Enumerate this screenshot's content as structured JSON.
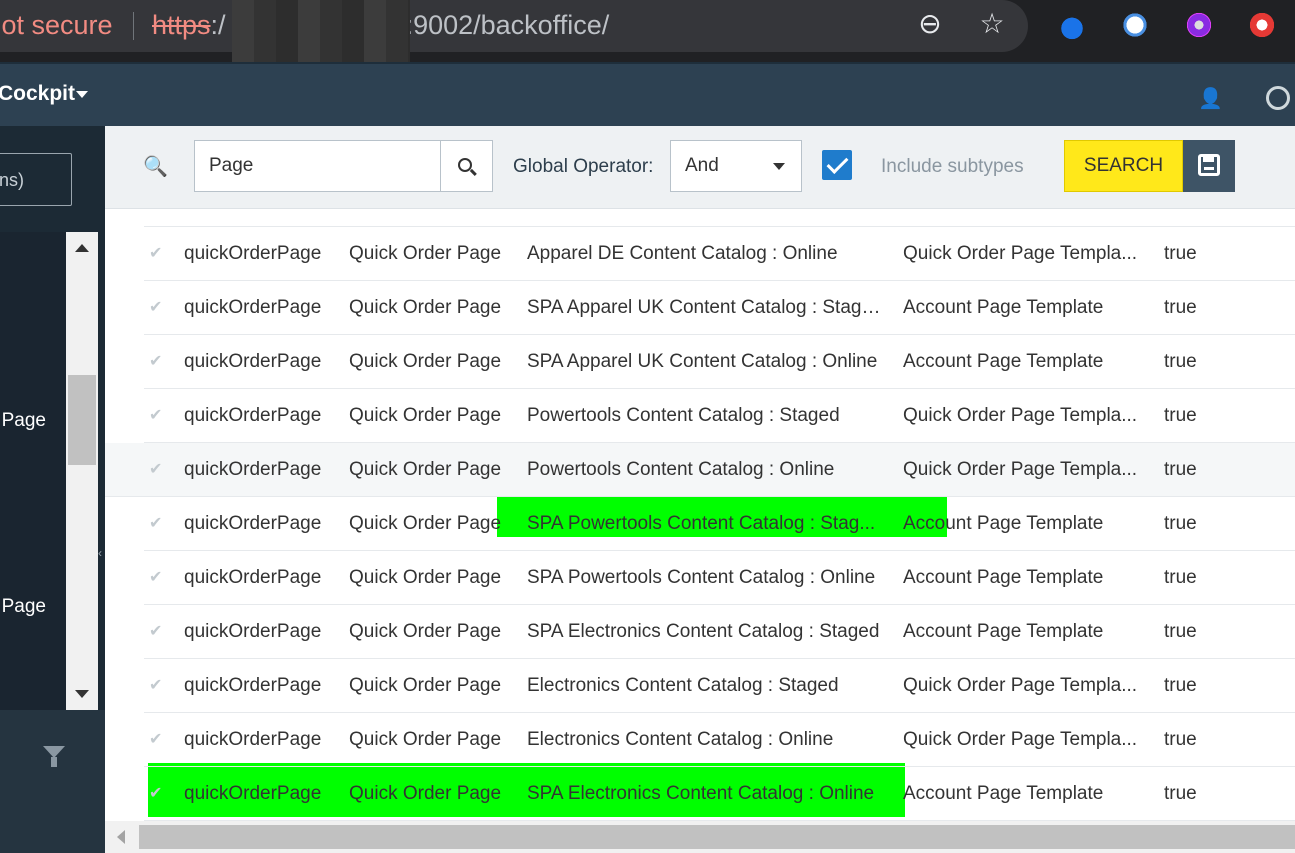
{
  "browser": {
    "security": "Not secure",
    "url_protocol": "https",
    "url_rest": ":9002/backoffice/"
  },
  "app": {
    "title": "Cockpit"
  },
  "left_panel": {
    "search_text": "ns)",
    "items": [
      "Page",
      "Page"
    ]
  },
  "search": {
    "query": "Page",
    "global_operator_label": "Global Operator:",
    "global_operator_value": "And",
    "include_subtypes_label": "Include subtypes",
    "include_subtypes_checked": true,
    "search_button": "SEARCH"
  },
  "table": {
    "rows": [
      {
        "uid": "quickOrderPage",
        "name": "Quick Order Page",
        "catalog": "Apparel DE Content Catalog : Online",
        "template": "Quick Order Page Templa...",
        "flag": "true"
      },
      {
        "uid": "quickOrderPage",
        "name": "Quick Order Page",
        "catalog": "SPA Apparel UK Content Catalog : Staged",
        "template": "Account Page Template",
        "flag": "true"
      },
      {
        "uid": "quickOrderPage",
        "name": "Quick Order Page",
        "catalog": "SPA Apparel UK Content Catalog : Online",
        "template": "Account Page Template",
        "flag": "true"
      },
      {
        "uid": "quickOrderPage",
        "name": "Quick Order Page",
        "catalog": "Powertools Content Catalog : Staged",
        "template": "Quick Order Page Templa...",
        "flag": "true"
      },
      {
        "uid": "quickOrderPage",
        "name": "Quick Order Page",
        "catalog": "Powertools Content Catalog : Online",
        "template": "Quick Order Page Templa...",
        "flag": "true"
      },
      {
        "uid": "quickOrderPage",
        "name": "Quick Order Page",
        "catalog": "SPA Powertools Content Catalog : Stag...",
        "template": "Account Page Template",
        "flag": "true"
      },
      {
        "uid": "quickOrderPage",
        "name": "Quick Order Page",
        "catalog": "SPA Powertools Content Catalog : Online",
        "template": "Account Page Template",
        "flag": "true"
      },
      {
        "uid": "quickOrderPage",
        "name": "Quick Order Page",
        "catalog": "SPA Electronics Content Catalog : Staged",
        "template": "Account Page Template",
        "flag": "true"
      },
      {
        "uid": "quickOrderPage",
        "name": "Quick Order Page",
        "catalog": "Electronics Content Catalog : Staged",
        "template": "Quick Order Page Templa...",
        "flag": "true"
      },
      {
        "uid": "quickOrderPage",
        "name": "Quick Order Page",
        "catalog": "Electronics Content Catalog : Online",
        "template": "Quick Order Page Templa...",
        "flag": "true"
      },
      {
        "uid": "quickOrderPage",
        "name": "Quick Order Page",
        "catalog": "SPA Electronics Content Catalog : Online",
        "template": "Account Page Template",
        "flag": "true"
      }
    ]
  },
  "colors": {
    "highlight": "#00ff00",
    "search_button": "#ffe81a",
    "header": "#2d4152"
  }
}
